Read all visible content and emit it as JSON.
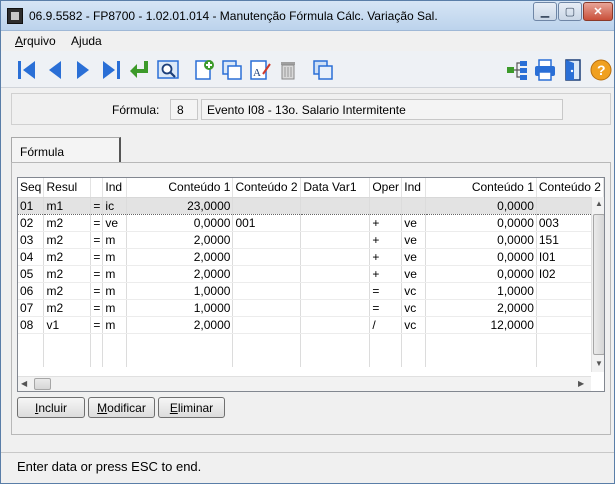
{
  "window": {
    "title": "06.9.5582 - FP8700 - 1.02.01.014 - Manutenção Fórmula Cálc. Variação Sal."
  },
  "menu": [
    {
      "label": "Arquivo",
      "accel": "A",
      "rest": "rquivo"
    },
    {
      "label": "Ajuda",
      "accel": "j",
      "pre": "A",
      "rest": "uda"
    }
  ],
  "toolbar": {
    "icons": [
      "first-record-icon",
      "previous-record-icon",
      "next-record-icon",
      "last-record-icon",
      "return-icon",
      "search-icon",
      "new-document-icon",
      "copy-icon",
      "edit-text-icon",
      "trash-icon",
      "duplicate-icon",
      "tree-structure-icon",
      "print-icon",
      "exit-door-icon",
      "help-icon"
    ]
  },
  "form": {
    "label": "Fórmula:",
    "code": "8",
    "description": "Evento I08 - 13o. Salario Intermitente"
  },
  "tab": {
    "label": "Fórmula"
  },
  "grid": {
    "columns": [
      "Seq",
      "Resul",
      "",
      "Ind",
      "Conteúdo 1",
      "Conteúdo 2",
      "Data Var1",
      "Oper",
      "Ind",
      "Conteúdo 1",
      "Conteúdo 2"
    ],
    "rows": [
      [
        "01",
        "m1",
        "=",
        "ic",
        "23,0000",
        "",
        "",
        "",
        "",
        "0,0000",
        ""
      ],
      [
        "02",
        "m2",
        "=",
        "ve",
        "0,0000",
        "001",
        "",
        "+",
        "ve",
        "0,0000",
        "003"
      ],
      [
        "03",
        "m2",
        "=",
        "m",
        "2,0000",
        "",
        "",
        "+",
        "ve",
        "0,0000",
        "151"
      ],
      [
        "04",
        "m2",
        "=",
        "m",
        "2,0000",
        "",
        "",
        "+",
        "ve",
        "0,0000",
        "I01"
      ],
      [
        "05",
        "m2",
        "=",
        "m",
        "2,0000",
        "",
        "",
        "+",
        "ve",
        "0,0000",
        "I02"
      ],
      [
        "06",
        "m2",
        "=",
        "m",
        "1,0000",
        "",
        "",
        "=",
        "vc",
        "1,0000",
        ""
      ],
      [
        "07",
        "m2",
        "=",
        "m",
        "1,0000",
        "",
        "",
        "=",
        "vc",
        "2,0000",
        ""
      ],
      [
        "08",
        "v1",
        "=",
        "m",
        "2,0000",
        "",
        "",
        "/",
        "vc",
        "12,0000",
        ""
      ]
    ],
    "selected_row": 0
  },
  "buttons": {
    "incluir": {
      "accel": "I",
      "rest": "ncluir"
    },
    "modificar": {
      "accel": "M",
      "rest": "odificar"
    },
    "eliminar": {
      "accel": "E",
      "rest": "liminar"
    }
  },
  "status": {
    "text": "Enter data or press ESC to end."
  },
  "colors": {
    "accent_blue": "#2a6fd6",
    "green": "#3c9a2a",
    "help_orange": "#f0a020"
  }
}
